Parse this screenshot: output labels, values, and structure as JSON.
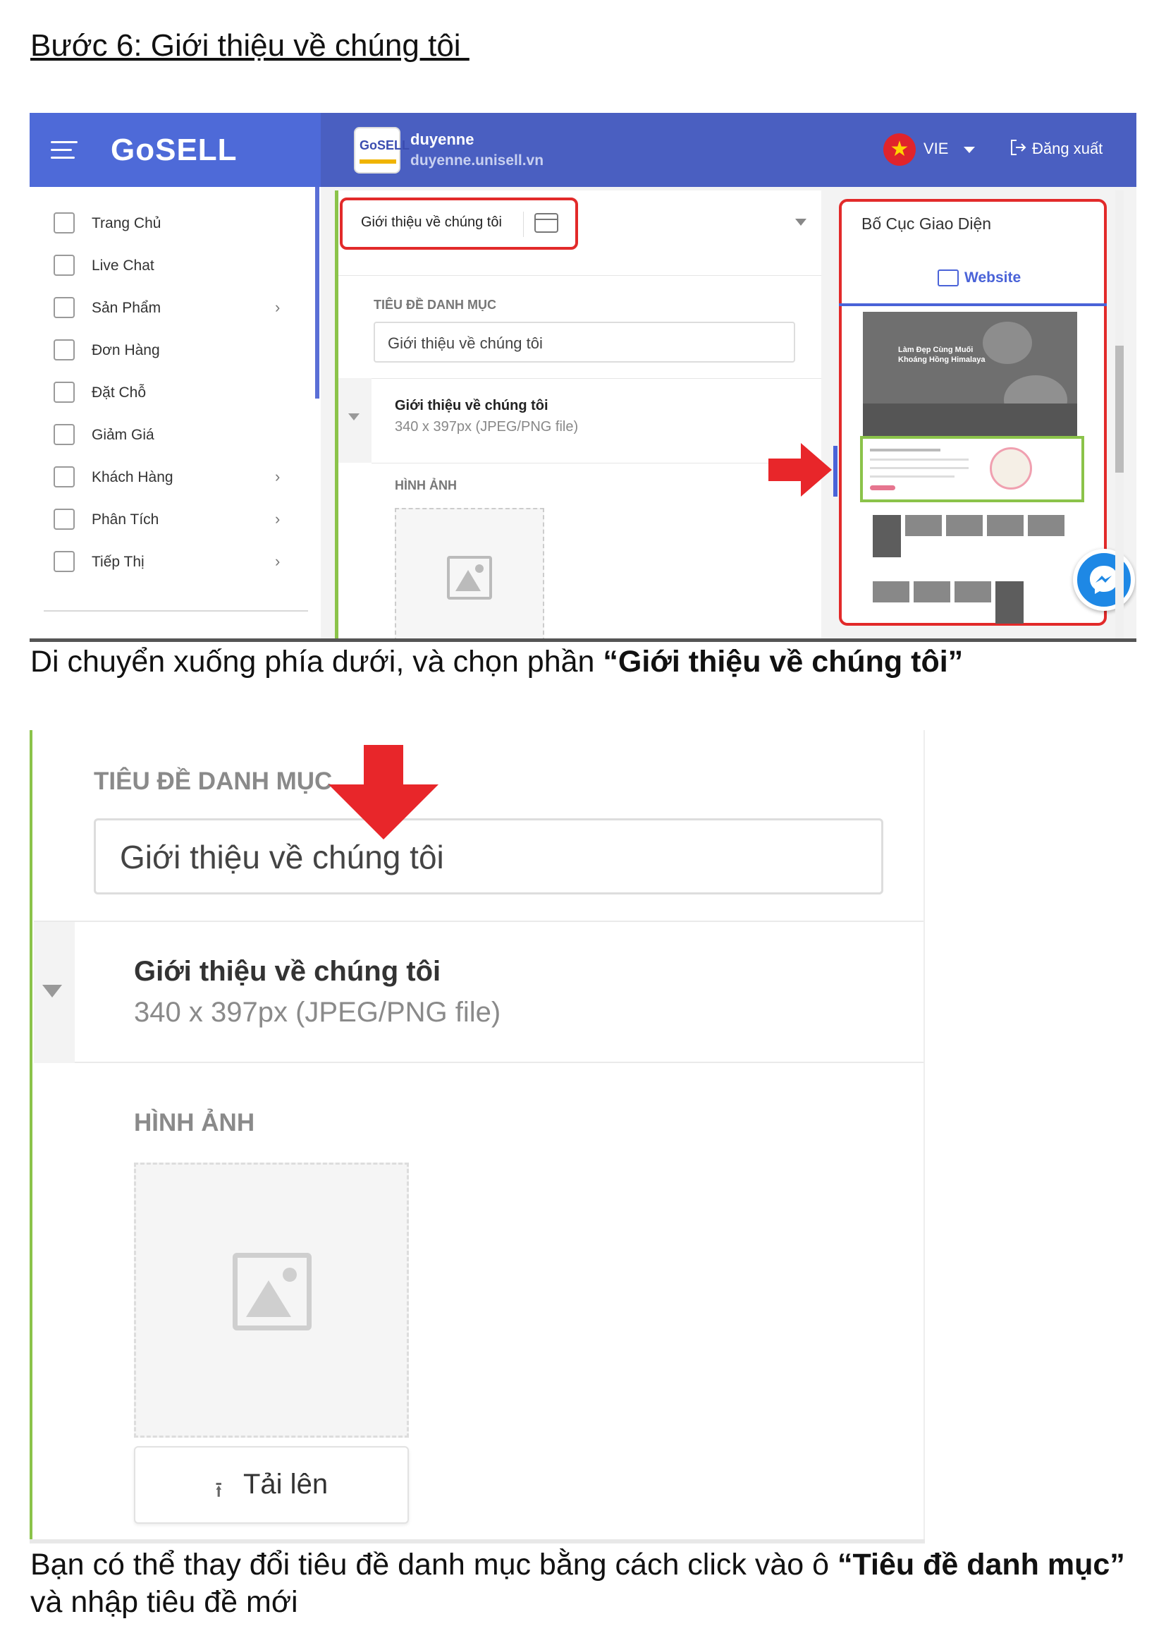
{
  "heading": "Bước 6: Giới thiệu về chúng tôi ",
  "screenshot1": {
    "brand": "GoSELL",
    "shop_logo_text": "GoSELL",
    "shop_name": "duyenne",
    "shop_url": "duyenne.unisell.vn",
    "language": "VIE",
    "logout": "Đăng xuất",
    "sidebar": [
      {
        "label": "Trang Chủ",
        "icon": "home-icon",
        "has_chevron": false
      },
      {
        "label": "Live Chat",
        "icon": "chat-icon",
        "has_chevron": false
      },
      {
        "label": "Sản Phẩm",
        "icon": "tag-icon",
        "has_chevron": true
      },
      {
        "label": "Đơn Hàng",
        "icon": "receipt-icon",
        "has_chevron": false
      },
      {
        "label": "Đặt Chỗ",
        "icon": "calendar-icon",
        "has_chevron": false
      },
      {
        "label": "Giảm Giá",
        "icon": "discount-icon",
        "has_chevron": false
      },
      {
        "label": "Khách Hàng",
        "icon": "users-icon",
        "has_chevron": true
      },
      {
        "label": "Phân Tích",
        "icon": "chart-icon",
        "has_chevron": true
      },
      {
        "label": "Tiếp Thị",
        "icon": "lightbulb-icon",
        "has_chevron": true
      }
    ],
    "chevron": "›",
    "section_title": "Giới thiệu về chúng tôi",
    "category_label": "TIÊU ĐỀ DANH MỤC",
    "category_value": "Giới thiệu về chúng tôi",
    "row_title": "Giới thiệu về chúng tôi",
    "row_sub": "340 x 397px (JPEG/PNG file)",
    "image_label": "HÌNH ẢNH",
    "preview_title": "Bố Cục Giao Diện",
    "preview_tab": "Website",
    "preview_hero_line1": "Làm Đẹp Cùng Muối",
    "preview_hero_line2": "Khoáng Hồng Himalaya"
  },
  "caption1": {
    "prefix": "Di chuyển xuống phía dưới, và chọn phần ",
    "bold": "“Giới thiệu về chúng tôi”"
  },
  "screenshot2": {
    "category_label": "TIÊU ĐỀ DANH MỤC",
    "category_value": "Giới thiệu về chúng tôi",
    "row_title": "Giới thiệu về chúng tôi",
    "row_sub": "340 x 397px (JPEG/PNG file)",
    "image_label": "HÌNH ẢNH",
    "upload_label": "Tải lên",
    "upload_icon": "upload-icon"
  },
  "caption2": {
    "prefix": "Bạn có thể thay đổi tiêu đề danh mục bằng cách click vào ô ",
    "bold": "“Tiêu đề danh mục”",
    "suffix": " và nhập tiêu đề mới"
  },
  "colors": {
    "header_blue": "#4a5fc1",
    "accent_green": "#8bc34a",
    "highlight_red": "#e22a2a",
    "link_blue": "#4a63d8"
  }
}
